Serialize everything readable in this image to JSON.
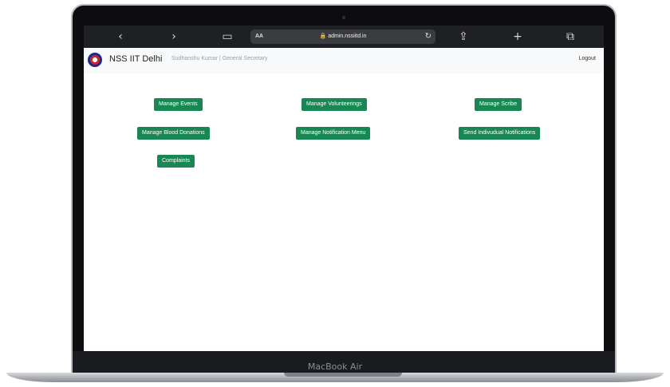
{
  "device": {
    "label": "MacBook Air"
  },
  "browser": {
    "back_icon": "chevron-left-icon",
    "forward_icon": "chevron-right-icon",
    "bookmarks_icon": "book-icon",
    "reader_label": "AA",
    "url": "admin.nssiitd.in",
    "reload_icon": "reload-icon",
    "share_icon": "share-icon",
    "new_tab_icon": "plus-icon",
    "tabs_icon": "tabs-icon"
  },
  "navbar": {
    "brand": "NSS IIT Delhi",
    "user": "Sudhanshu Kumar | General Secretary",
    "logout": "Logout"
  },
  "actions": {
    "manage_events": "Manage Events",
    "manage_volunteerings": "Manage Volunteerings",
    "manage_scribe": "Manage Scribe",
    "manage_blood_donations": "Manage Blood Donations",
    "manage_notification_menu": "Manage Notification Menu",
    "send_notifications": "Send Indivudual Notifications",
    "complaints": "Complaints"
  },
  "colors": {
    "button": "#198754",
    "navbar_bg": "#f8f9fa",
    "toolbar_bg": "#1f2024"
  }
}
